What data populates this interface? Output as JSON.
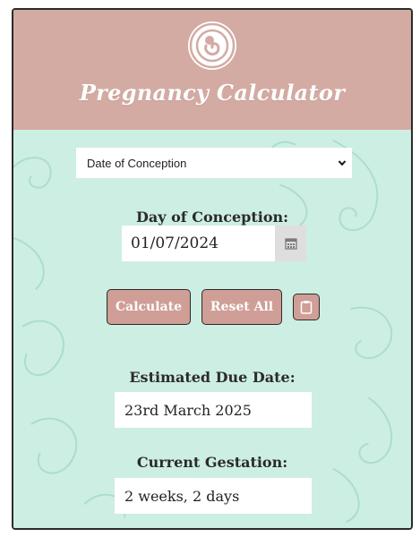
{
  "header": {
    "title": "Pregnancy Calculator",
    "logo_icon": "baby-in-womb-icon",
    "background": "#d3aba3"
  },
  "form": {
    "method_select": {
      "selected": "Date of Conception",
      "icon": "chevron-down-icon"
    },
    "date_label": "Day of Conception:",
    "date_value": "01/07/2024",
    "calendar_icon": "calendar-icon"
  },
  "actions": {
    "calculate_label": "Calculate",
    "reset_label": "Reset All",
    "copy_icon": "clipboard-icon",
    "button_color": "#cf9e96"
  },
  "results": {
    "due_date_label": "Estimated Due Date:",
    "due_date_value": "23rd March 2025",
    "gestation_label": "Current Gestation:",
    "gestation_value": "2 weeks, 2 days"
  },
  "theme": {
    "body_background": "#cdeee3",
    "swirl_color": "#a8dccb"
  }
}
